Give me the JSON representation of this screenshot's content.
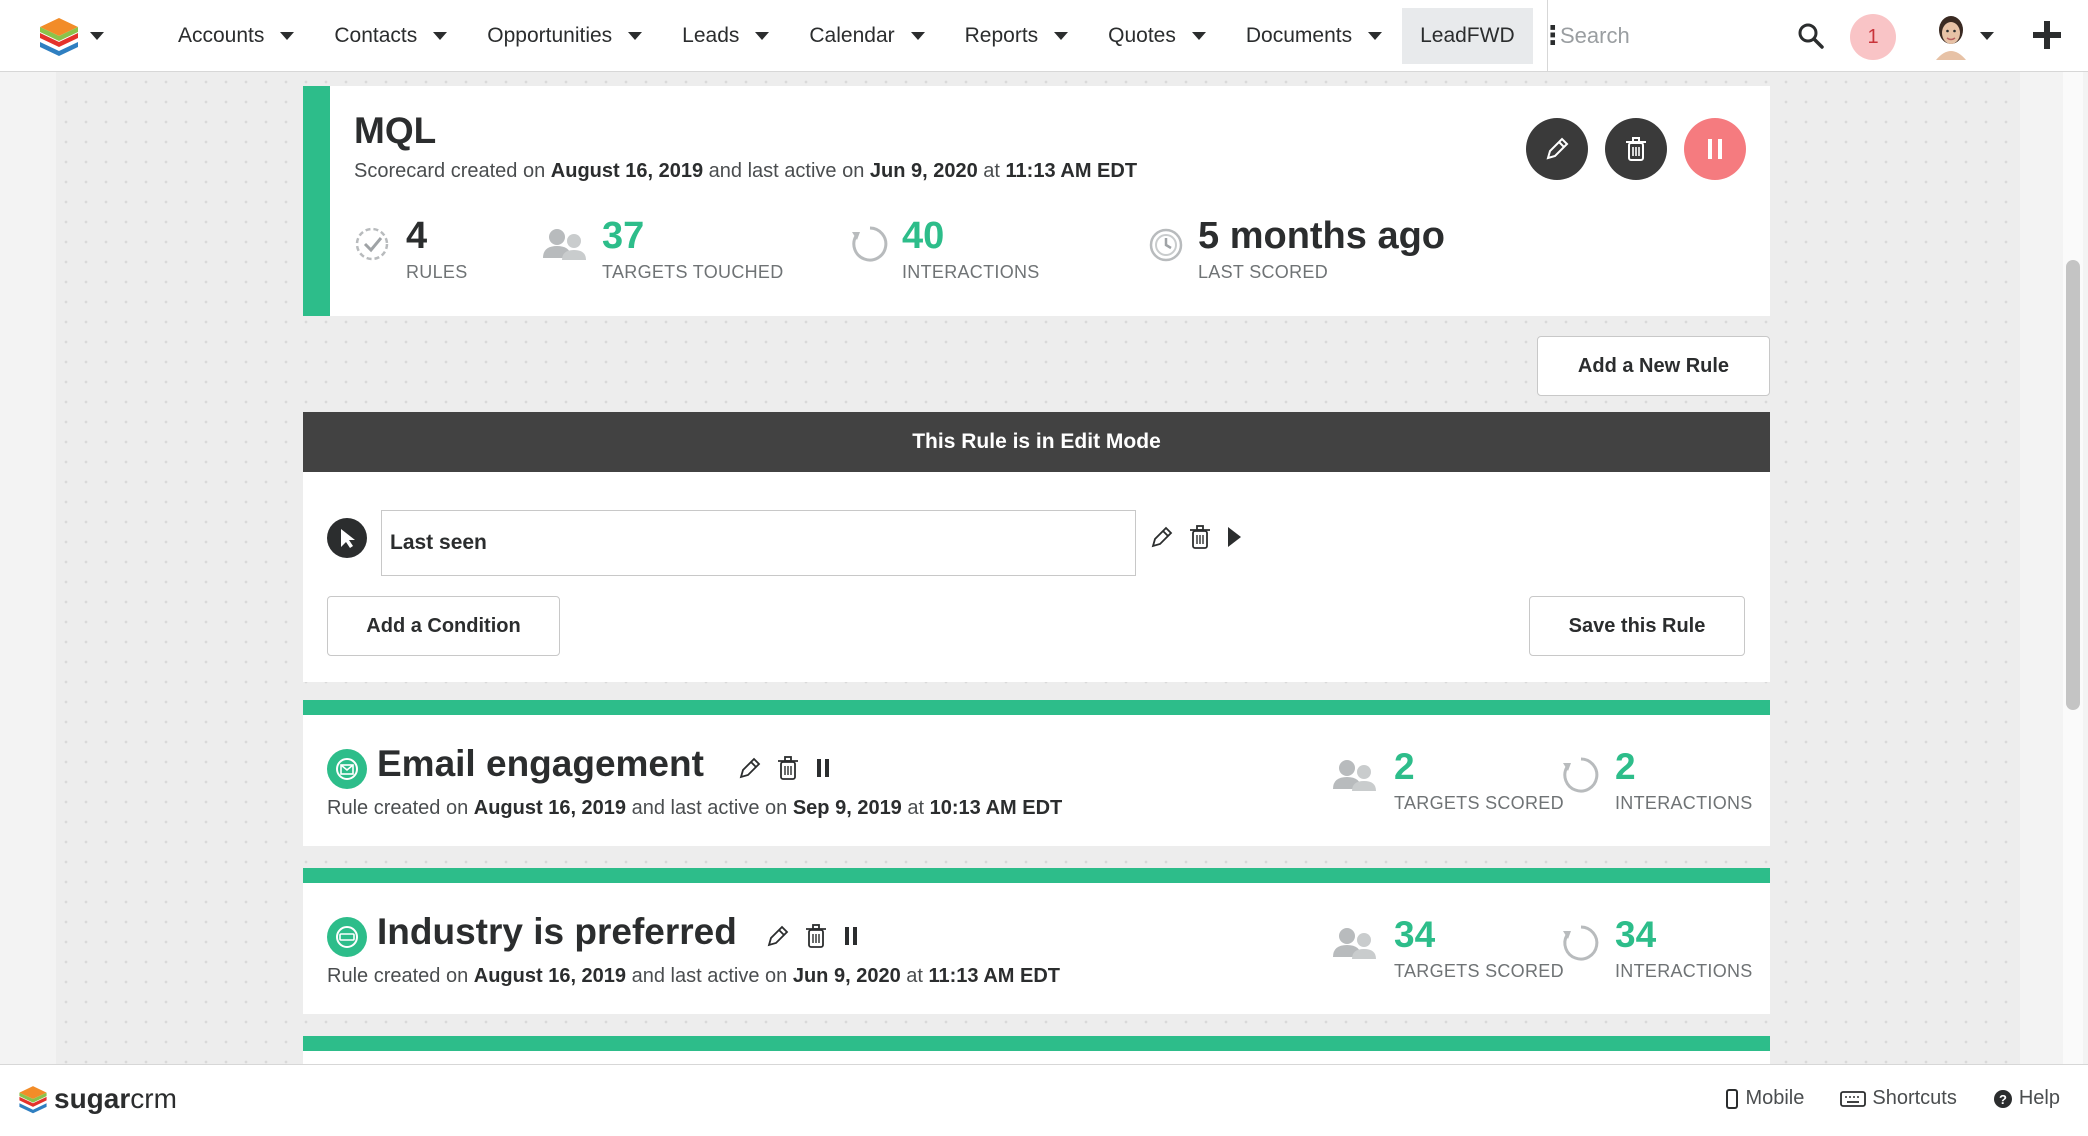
{
  "nav": {
    "items": [
      {
        "label": "Accounts"
      },
      {
        "label": "Contacts"
      },
      {
        "label": "Opportunities"
      },
      {
        "label": "Leads"
      },
      {
        "label": "Calendar"
      },
      {
        "label": "Reports"
      },
      {
        "label": "Quotes"
      },
      {
        "label": "Documents"
      }
    ],
    "active_tab": "LeadFWD",
    "search_placeholder": "Search",
    "notification_count": "1"
  },
  "scorecard": {
    "title": "MQL",
    "sub_prefix": "Scorecard created on",
    "created": "August 16, 2019",
    "sub_mid": "and last active on",
    "last_active_date": "Jun 9, 2020",
    "sub_at": "at",
    "last_active_time": "11:13 AM EDT",
    "stats": {
      "rules_value": "4",
      "rules_label": "RULES",
      "targets_value": "37",
      "targets_label": "TARGETS TOUCHED",
      "interactions_value": "40",
      "interactions_label": "INTERACTIONS",
      "scored_value": "5 months ago",
      "scored_label": "LAST SCORED"
    }
  },
  "add_rule_label": "Add a New Rule",
  "edit": {
    "banner": "This Rule is in Edit Mode",
    "condition_value": "Last seen",
    "add_condition_label": "Add a Condition",
    "save_label": "Save this Rule"
  },
  "rules": [
    {
      "title": "Email engagement",
      "sub_prefix": "Rule created on",
      "created": "August 16, 2019",
      "sub_mid": "and last active on",
      "last_active_date": "Sep 9, 2019",
      "sub_at": "at",
      "last_active_time": "10:13 AM EDT",
      "targets_value": "2",
      "targets_label": "TARGETS SCORED",
      "interactions_value": "2",
      "interactions_label": "INTERACTIONS"
    },
    {
      "title": "Industry is preferred",
      "sub_prefix": "Rule created on",
      "created": "August 16, 2019",
      "sub_mid": "and last active on",
      "last_active_date": "Jun 9, 2020",
      "sub_at": "at",
      "last_active_time": "11:13 AM EDT",
      "targets_value": "34",
      "targets_label": "TARGETS SCORED",
      "interactions_value": "34",
      "interactions_label": "INTERACTIONS"
    }
  ],
  "footer": {
    "brand_bold": "sugar",
    "brand_rest": "crm",
    "mobile": "Mobile",
    "shortcuts": "Shortcuts",
    "help": "Help"
  },
  "colors": {
    "accent": "#2dbd8a",
    "pause_button": "#f57b7f",
    "dark_button": "#3a3a3a",
    "edit_banner": "#424242"
  }
}
